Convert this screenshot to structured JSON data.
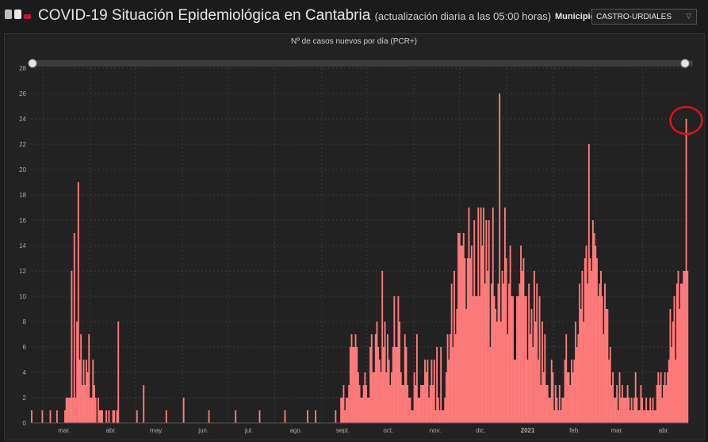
{
  "header": {
    "title": "COVID-19 Situación Epidemiológica en Cantabria",
    "subtitle": "(actualización diaria a las 05:00 horas)",
    "municipio_label": "Municipio",
    "municipio_value": "CASTRO-URDIALES",
    "flag_colors": [
      "#c0c0c0",
      "#c8102e"
    ]
  },
  "chart_data": {
    "type": "bar",
    "title": "Nº de casos nuevos por día (PCR+)",
    "ylim": [
      0,
      28
    ],
    "yticks": [
      0,
      2,
      4,
      6,
      8,
      10,
      12,
      14,
      16,
      18,
      20,
      22,
      24,
      26,
      28
    ],
    "x_start": "2020-02-22",
    "x_end": "2021-04-30",
    "month_labels": [
      {
        "date": "2020-03-15",
        "label": "mar."
      },
      {
        "date": "2020-04-15",
        "label": "abr."
      },
      {
        "date": "2020-05-15",
        "label": "may."
      },
      {
        "date": "2020-06-15",
        "label": "jun."
      },
      {
        "date": "2020-07-15",
        "label": "jul."
      },
      {
        "date": "2020-08-15",
        "label": "ago."
      },
      {
        "date": "2020-09-15",
        "label": "sept."
      },
      {
        "date": "2020-10-15",
        "label": "oct."
      },
      {
        "date": "2020-11-15",
        "label": "nov."
      },
      {
        "date": "2020-12-15",
        "label": "dic."
      },
      {
        "date": "2021-01-15",
        "label": "2021"
      },
      {
        "date": "2021-02-15",
        "label": "feb."
      },
      {
        "date": "2021-03-15",
        "label": "mar."
      },
      {
        "date": "2021-04-15",
        "label": "abr."
      }
    ],
    "series": [
      {
        "color": "#ff7b7b",
        "values": [
          1,
          0,
          0,
          0,
          0,
          0,
          0,
          0,
          1,
          0,
          0,
          0,
          0,
          0,
          1,
          0,
          0,
          0,
          0,
          1,
          0,
          0,
          0,
          0,
          0,
          1,
          2,
          2,
          2,
          2,
          12,
          2,
          15,
          2,
          8,
          19,
          5,
          7,
          3,
          5,
          3,
          5,
          4,
          7,
          2,
          2,
          5,
          3,
          2,
          0,
          2,
          1,
          1,
          1,
          0,
          0,
          1,
          0,
          1,
          0,
          0,
          1,
          1,
          0,
          1,
          8,
          0,
          0,
          0,
          0,
          0,
          0,
          0,
          0,
          0,
          0,
          0,
          0,
          0,
          1,
          0,
          0,
          0,
          0,
          3,
          0,
          0,
          0,
          0,
          0,
          0,
          0,
          0,
          0,
          0,
          0,
          0,
          0,
          0,
          0,
          0,
          1,
          0,
          0,
          0,
          0,
          0,
          0,
          0,
          0,
          0,
          0,
          0,
          0,
          2,
          0,
          0,
          0,
          0,
          0,
          0,
          0,
          0,
          0,
          0,
          0,
          0,
          0,
          0,
          0,
          0,
          0,
          0,
          1,
          0,
          0,
          0,
          0,
          0,
          0,
          0,
          0,
          0,
          0,
          0,
          0,
          0,
          0,
          0,
          0,
          0,
          0,
          0,
          1,
          0,
          0,
          0,
          0,
          0,
          0,
          0,
          0,
          0,
          0,
          0,
          0,
          0,
          0,
          0,
          0,
          0,
          1,
          0,
          0,
          0,
          0,
          0,
          0,
          0,
          0,
          0,
          0,
          0,
          0,
          0,
          0,
          0,
          0,
          0,
          0,
          1,
          0,
          0,
          0,
          0,
          0,
          0,
          0,
          0,
          0,
          0,
          0,
          0,
          0,
          0,
          0,
          0,
          1,
          0,
          0,
          0,
          0,
          0,
          1,
          0,
          0,
          0,
          0,
          0,
          0,
          0,
          0,
          0,
          0,
          0,
          0,
          0,
          0,
          1,
          0,
          0,
          0,
          2,
          2,
          3,
          1,
          2,
          2,
          3,
          6,
          7,
          6,
          6,
          7,
          6,
          4,
          3,
          2,
          2,
          3,
          4,
          3,
          2,
          2,
          6,
          7,
          4,
          4,
          7,
          8,
          6,
          5,
          4,
          12,
          6,
          8,
          4,
          7,
          5,
          3,
          4,
          6,
          10,
          6,
          6,
          10,
          8,
          4,
          3,
          3,
          7,
          6,
          3,
          2,
          2,
          1,
          1,
          4,
          3,
          7,
          2,
          2,
          3,
          3,
          3,
          5,
          4,
          5,
          2,
          3,
          5,
          3,
          5,
          1,
          6,
          2,
          1,
          6,
          1,
          1,
          2,
          4,
          7,
          5,
          7,
          11,
          6,
          12,
          7,
          9,
          15,
          15,
          14,
          14,
          15,
          13,
          9,
          13,
          17,
          13,
          14,
          10,
          16,
          10,
          10,
          17,
          10,
          17,
          14,
          17,
          11,
          16,
          12,
          16,
          6,
          11,
          17,
          10,
          9,
          8,
          11,
          26,
          8,
          12,
          11,
          17,
          13,
          7,
          11,
          14,
          10,
          10,
          5,
          5,
          10,
          10,
          11,
          14,
          12,
          13,
          10,
          10,
          5,
          11,
          7,
          9,
          6,
          12,
          8,
          11,
          5,
          10,
          3,
          8,
          4,
          7,
          3,
          3,
          2,
          2,
          5,
          4,
          1,
          3,
          2,
          1,
          3,
          1,
          2,
          2,
          5,
          7,
          4,
          4,
          3,
          5,
          4,
          5,
          8,
          6,
          7,
          11,
          9,
          12,
          8,
          13,
          14,
          11,
          22,
          13,
          12,
          16,
          15,
          14,
          13,
          10,
          11,
          12,
          10,
          7,
          11,
          9,
          9,
          5,
          6,
          3,
          4,
          2,
          2,
          3,
          1,
          4,
          2,
          3,
          2,
          2,
          2,
          3,
          2,
          1,
          2,
          1,
          2,
          4,
          2,
          1,
          1,
          3,
          2,
          1,
          1,
          2,
          1,
          1,
          2,
          1,
          2,
          1,
          1,
          3,
          4,
          3,
          4,
          2,
          3,
          4,
          3,
          4,
          5,
          9,
          6,
          8,
          10,
          5,
          11,
          12,
          9,
          11,
          11,
          12,
          12,
          24,
          12
        ]
      }
    ]
  }
}
